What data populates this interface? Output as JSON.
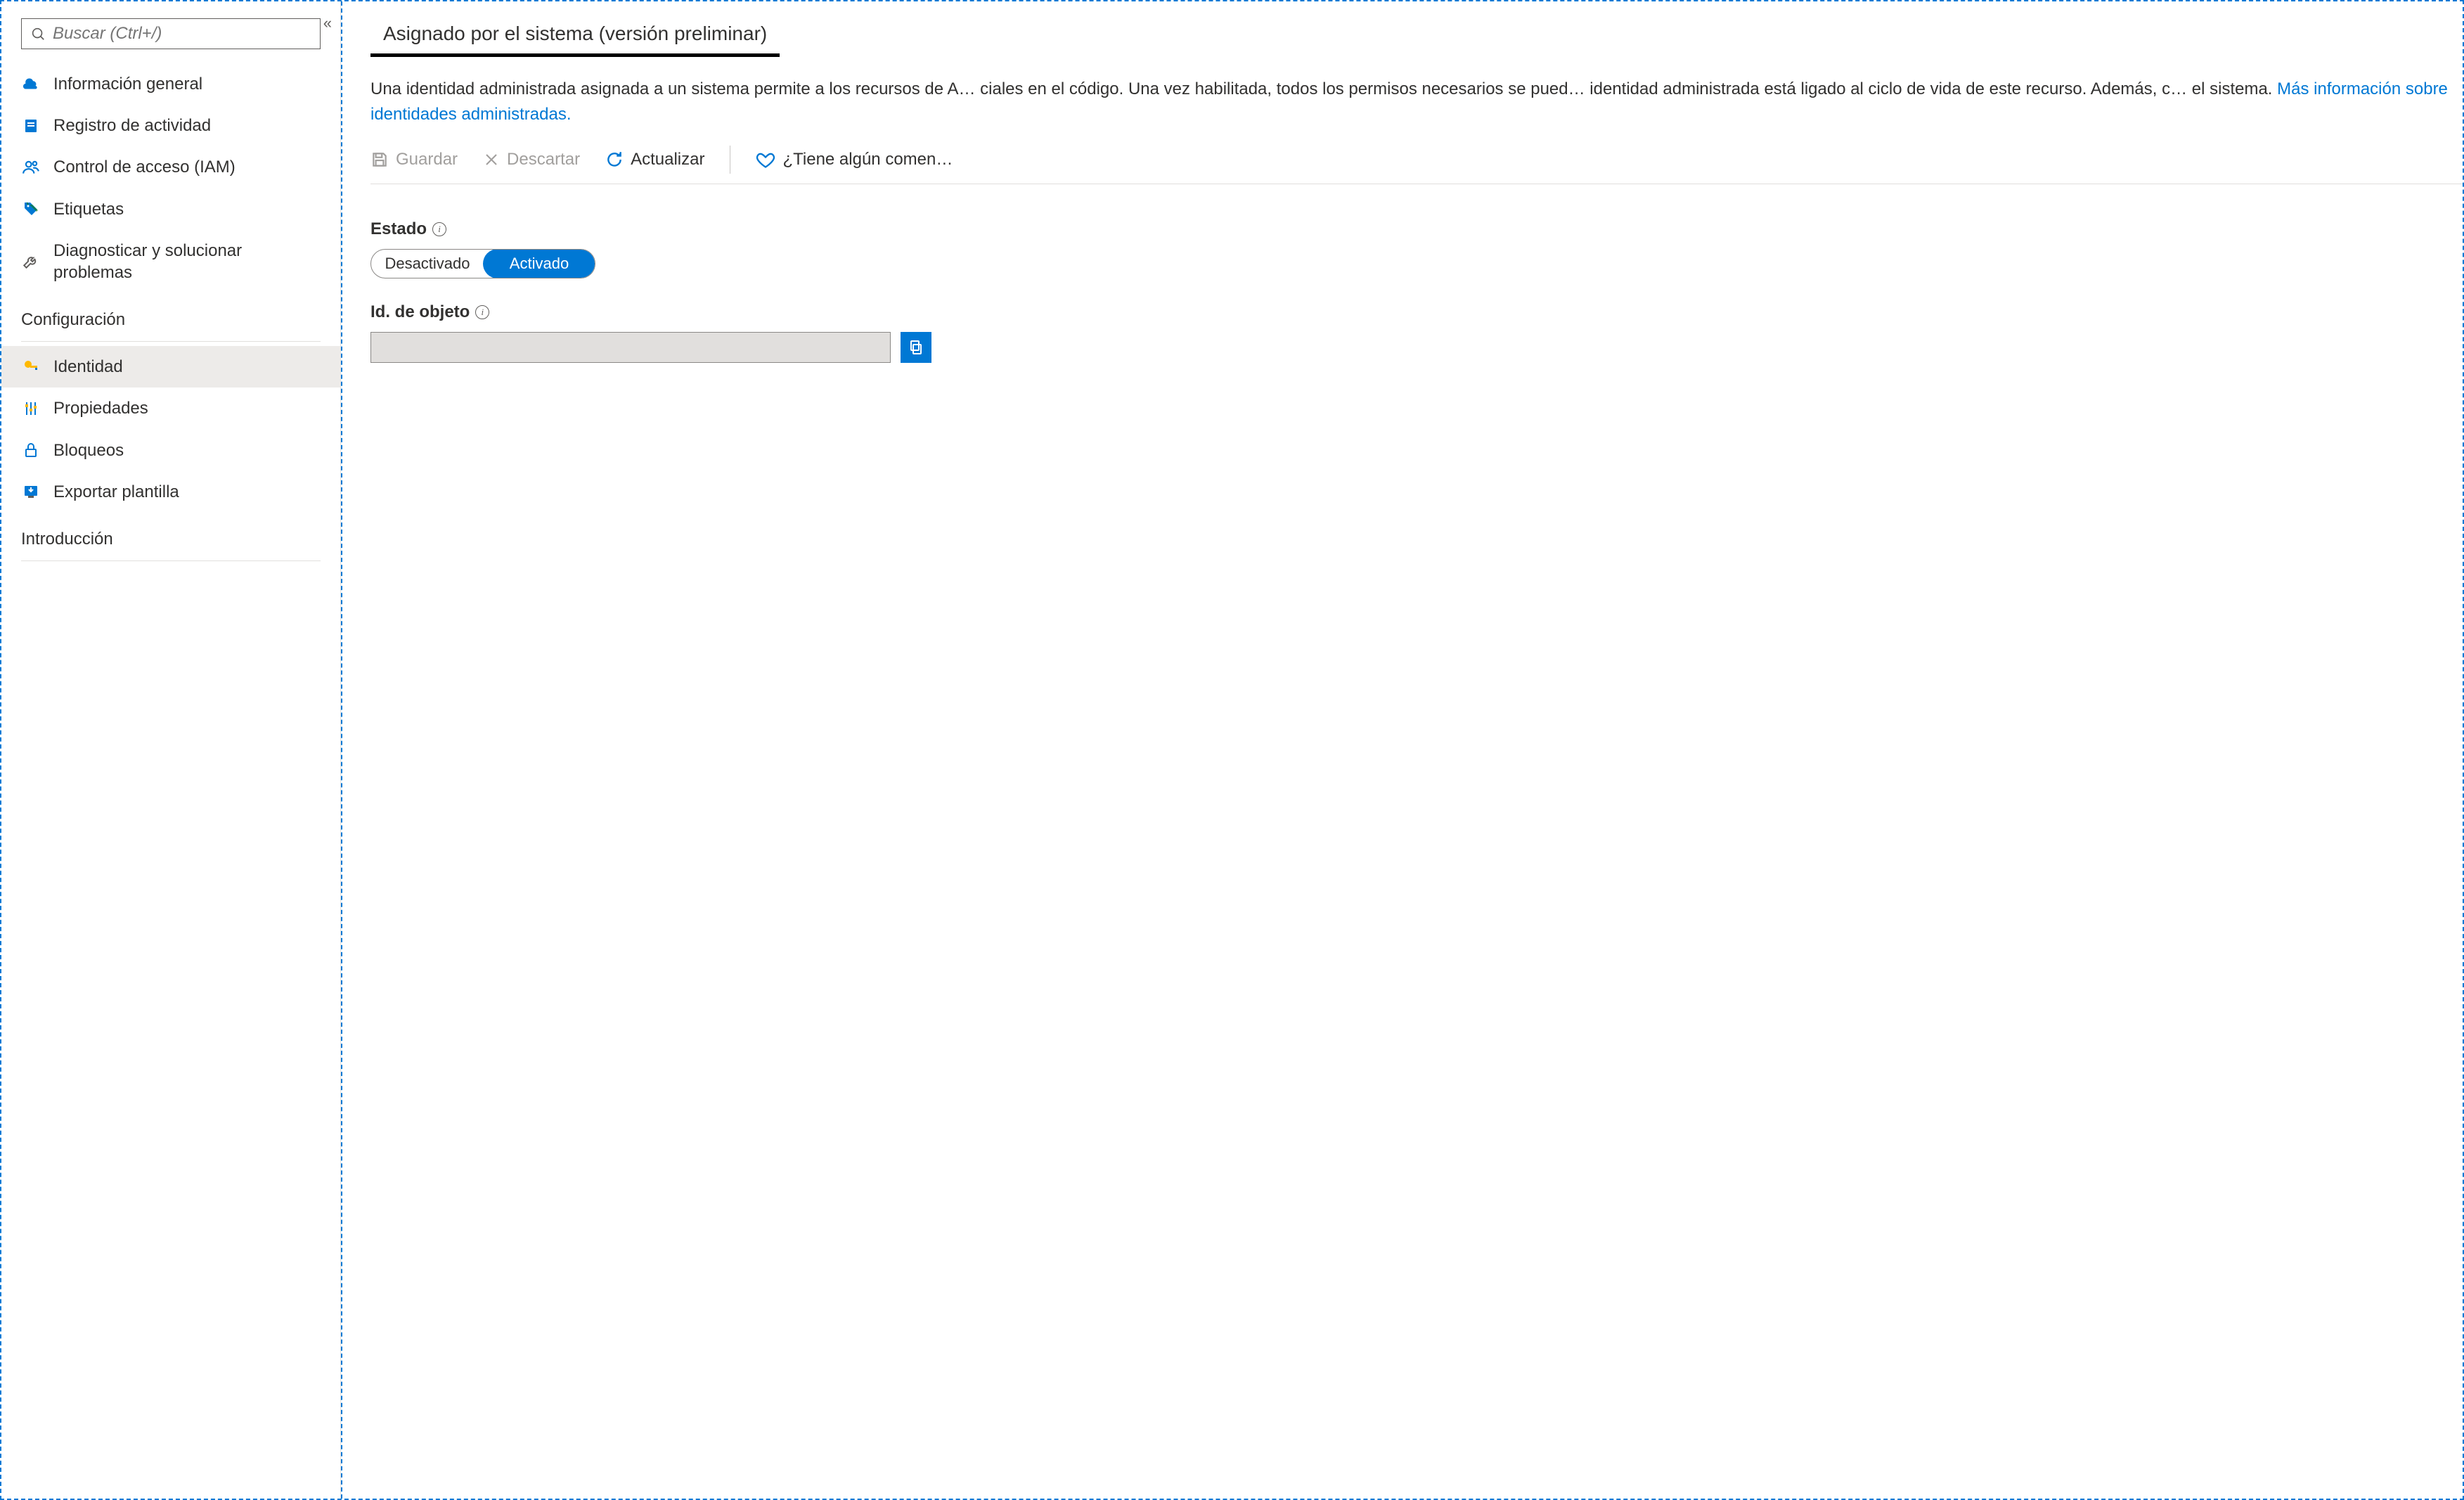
{
  "search": {
    "placeholder": "Buscar (Ctrl+/)"
  },
  "sidebar": {
    "items": [
      {
        "label": "Información general",
        "icon": "cloud"
      },
      {
        "label": "Registro de actividad",
        "icon": "log"
      },
      {
        "label": "Control de acceso (IAM)",
        "icon": "people"
      },
      {
        "label": "Etiquetas",
        "icon": "tags"
      },
      {
        "label": "Diagnosticar y solucionar problemas",
        "icon": "wrench"
      }
    ],
    "section_config": "Configuración",
    "config_items": [
      {
        "label": "Identidad",
        "icon": "key"
      },
      {
        "label": "Propiedades",
        "icon": "sliders"
      },
      {
        "label": "Bloqueos",
        "icon": "lock"
      },
      {
        "label": "Exportar plantilla",
        "icon": "export"
      }
    ],
    "section_intro": "Introducción"
  },
  "tab": {
    "label": "Asignado por el sistema (versión preliminar)"
  },
  "description": {
    "text": "Una identidad administrada asignada a un sistema permite a los recursos de A… ciales en el código. Una vez habilitada, todos los permisos necesarios se pued… identidad administrada está ligado al ciclo de vida de este recurso. Además, c… el sistema. ",
    "link": "Más información sobre identidades administradas."
  },
  "toolbar": {
    "save": "Guardar",
    "discard": "Descartar",
    "refresh": "Actualizar",
    "feedback": "¿Tiene algún comen…"
  },
  "fields": {
    "state_label": "Estado",
    "state_off": "Desactivado",
    "state_on": "Activado",
    "object_label": "Id. de objeto",
    "object_value": ""
  }
}
